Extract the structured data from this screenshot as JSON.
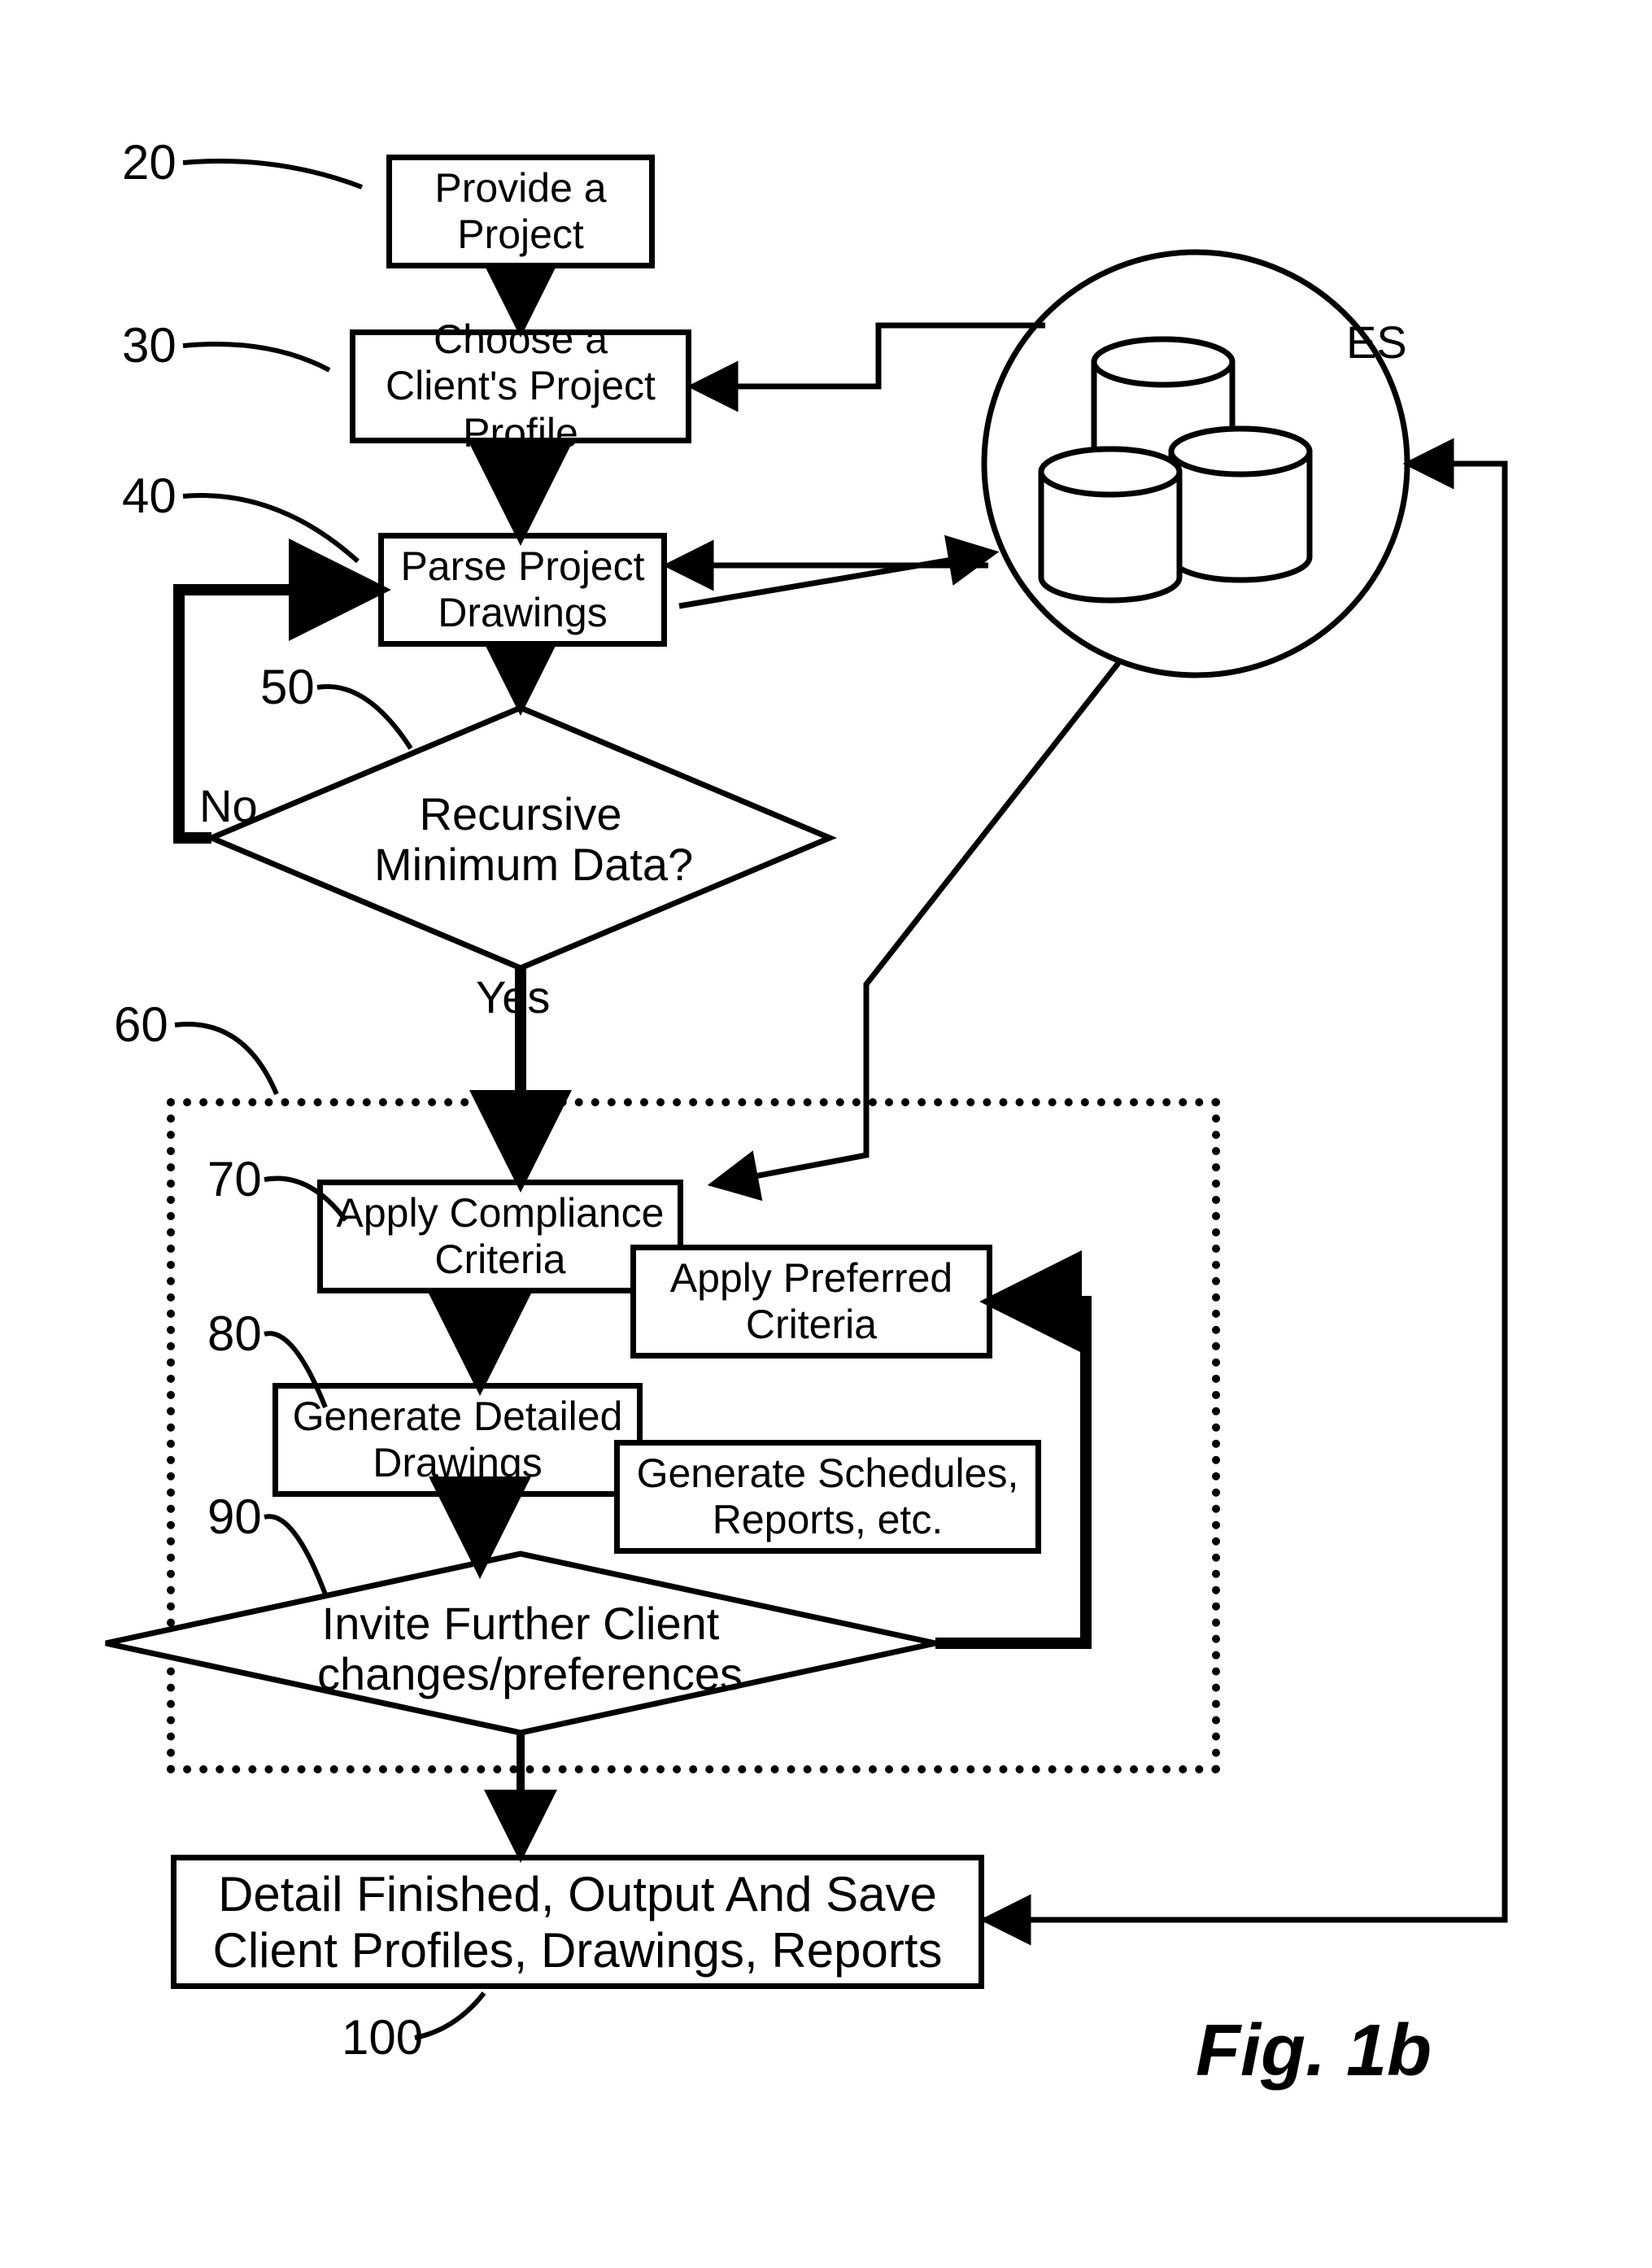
{
  "figure_label": "Fig. 1b",
  "refs": {
    "r20": "20",
    "r30": "30",
    "r40": "40",
    "r50": "50",
    "r60": "60",
    "r70": "70",
    "r80": "80",
    "r90": "90",
    "r100": "100"
  },
  "nodes": {
    "provide_project": "Provide a\nProject",
    "choose_profile": "Choose a Client's\nProject Profile",
    "parse_drawings": "Parse Project\nDrawings",
    "decision_min_data": "Recursive\nMinimum Data?",
    "decision_no": "No",
    "decision_yes": "Yes",
    "apply_compliance": "Apply Compliance\nCriteria",
    "apply_preferred": "Apply Preferred\nCriteria",
    "gen_drawings": "Generate Detailed\nDrawings",
    "gen_schedules": "Generate Schedules,\nReports, etc.",
    "invite_changes": "Invite Further Client\nchanges/preferences",
    "final_output": "Detail  Finished, Output And Save\nClient Profiles, Drawings, Reports",
    "es_label": "ES"
  }
}
